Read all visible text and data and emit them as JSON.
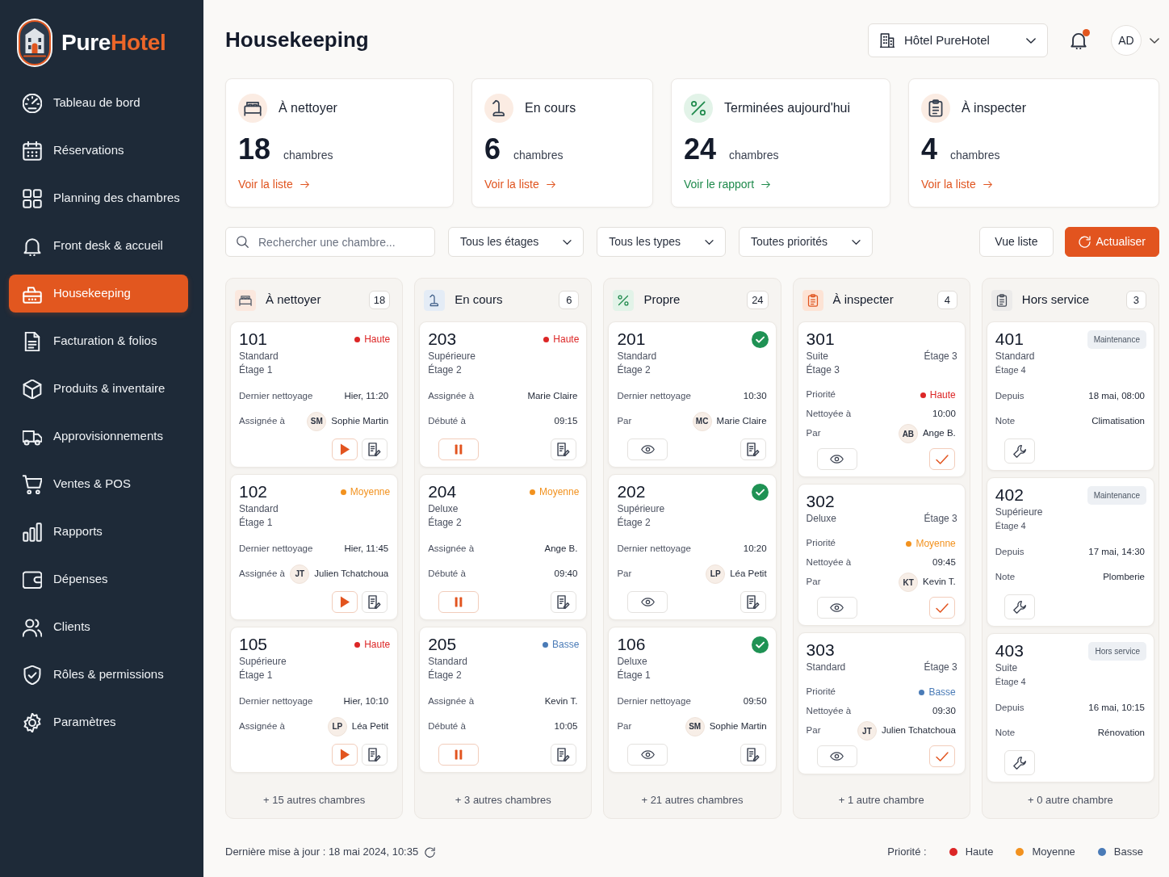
{
  "sidebar": {
    "brand": {
      "name": "Pure",
      "name_accent": "Hotel"
    },
    "items": [
      {
        "label": "Tableau de bord",
        "selected": false
      },
      {
        "label": "Réservations",
        "selected": false
      },
      {
        "label": "Planning des chambres",
        "selected": false
      },
      {
        "label": "Front desk & accueil",
        "selected": false
      },
      {
        "label": "Housekeeping",
        "selected": true
      },
      {
        "label": "Facturation & folios",
        "selected": false
      },
      {
        "label": "Produits & inventaire",
        "selected": false
      },
      {
        "label": "Approvisionnements",
        "selected": false
      },
      {
        "label": "Ventes & POS",
        "selected": false
      },
      {
        "label": "Rapports",
        "selected": false
      },
      {
        "label": "Dépenses",
        "selected": false
      },
      {
        "label": "Clients",
        "selected": false
      },
      {
        "label": "Rôles & permissions",
        "selected": false
      },
      {
        "label": "Paramètres",
        "selected": false
      }
    ]
  },
  "header": {
    "title": "Housekeeping",
    "hotel_select": {
      "value": "Hôtel PureHotel"
    },
    "notifications": {
      "unread": true
    },
    "user": {
      "initials": "AD"
    }
  },
  "stats": [
    {
      "kind": "to_clean",
      "title": "À nettoyer",
      "count": "18",
      "unit": "chambres",
      "link": "Voir la liste"
    },
    {
      "kind": "in_progress",
      "title": "En cours",
      "count": "6",
      "unit": "chambres",
      "link": "Voir la liste"
    },
    {
      "kind": "done",
      "title": "Terminées aujourd'hui",
      "count": "24",
      "unit": "chambres",
      "link": "Voir le rapport"
    },
    {
      "kind": "inspect",
      "title": "À inspecter",
      "count": "4",
      "unit": "chambres",
      "link": "Voir la liste"
    }
  ],
  "filters": {
    "search": {
      "placeholder": "Rechercher une chambre..."
    },
    "selects": [
      {
        "value": "Tous les étages"
      },
      {
        "value": "Tous les types"
      },
      {
        "value": "Toutes priorités"
      }
    ],
    "buttons": [
      {
        "kind": "view_mode",
        "label": "Vue liste"
      },
      {
        "kind": "refresh",
        "label": "Actualiser"
      }
    ]
  },
  "board": {
    "columns": [
      {
        "kind": "to_clean",
        "title": "À nettoyer",
        "count": "18",
        "cards": [
          {
            "number": "101",
            "priority": {
              "label": "Haute",
              "color": "#dc2626"
            },
            "room_type": "Standard",
            "floor": "Étage 1",
            "rows": [
              {
                "kind": "text",
                "label": "Dernier nettoyage",
                "value": "Hier, 11:20"
              },
              {
                "kind": "person",
                "label": "Assignée à",
                "initials": "SM",
                "value": "Sophie Martin"
              }
            ],
            "actions": [
              {
                "kind": "start"
              },
              {
                "kind": "notes"
              }
            ]
          },
          {
            "number": "102",
            "priority": {
              "label": "Moyenne",
              "color": "#f2921f"
            },
            "room_type": "Standard",
            "floor": "Étage 1",
            "rows": [
              {
                "kind": "text",
                "label": "Dernier nettoyage",
                "value": "Hier, 11:45"
              },
              {
                "kind": "person",
                "label": "Assignée à",
                "initials": "JT",
                "value": "Julien Tchatchoua"
              }
            ],
            "actions": [
              {
                "kind": "start"
              },
              {
                "kind": "notes"
              }
            ]
          },
          {
            "number": "105",
            "priority": {
              "label": "Haute",
              "color": "#dc2626"
            },
            "room_type": "Supérieure",
            "floor": "Étage 1",
            "rows": [
              {
                "kind": "text",
                "label": "Dernier nettoyage",
                "value": "Hier, 10:10"
              },
              {
                "kind": "person",
                "label": "Assignée à",
                "initials": "LP",
                "value": "Léa Petit"
              }
            ],
            "actions": [
              {
                "kind": "start"
              },
              {
                "kind": "notes"
              }
            ]
          }
        ],
        "more": "+ 15 autres chambres"
      },
      {
        "kind": "in_progress",
        "title": "En cours",
        "count": "6",
        "cards": [
          {
            "number": "203",
            "priority": {
              "label": "Haute",
              "color": "#dc2626"
            },
            "room_type": "Supérieure",
            "floor": "Étage 2",
            "rows": [
              {
                "kind": "text",
                "label": "Assignée à",
                "value": "Marie Claire"
              },
              {
                "kind": "text",
                "label": "Débuté à",
                "value": "09:15"
              }
            ],
            "actions": [
              {
                "kind": "pause"
              },
              {
                "kind": "notes"
              }
            ]
          },
          {
            "number": "204",
            "priority": {
              "label": "Moyenne",
              "color": "#f2921f"
            },
            "room_type": "Deluxe",
            "floor": "Étage 2",
            "rows": [
              {
                "kind": "text",
                "label": "Assignée à",
                "value": "Ange B."
              },
              {
                "kind": "text",
                "label": "Débuté à",
                "value": "09:40"
              }
            ],
            "actions": [
              {
                "kind": "pause"
              },
              {
                "kind": "notes"
              }
            ]
          },
          {
            "number": "205",
            "priority": {
              "label": "Basse",
              "color": "#4a7bb7"
            },
            "room_type": "Standard",
            "floor": "Étage 2",
            "rows": [
              {
                "kind": "text",
                "label": "Assignée à",
                "value": "Kevin T."
              },
              {
                "kind": "text",
                "label": "Débuté à",
                "value": "10:05"
              }
            ],
            "actions": [
              {
                "kind": "pause"
              },
              {
                "kind": "notes"
              }
            ]
          }
        ],
        "more": "+ 3 autres chambres"
      },
      {
        "kind": "done",
        "title": "Propre",
        "count": "24",
        "cards": [
          {
            "number": "201",
            "done": true,
            "room_type": "Standard",
            "floor": "Étage 2",
            "rows": [
              {
                "kind": "text",
                "label": "Dernier nettoyage",
                "value": "10:30"
              },
              {
                "kind": "person",
                "label": "Par",
                "initials": "MC",
                "value": "Marie Claire"
              }
            ],
            "actions": [
              {
                "kind": "view"
              },
              {
                "kind": "notes"
              }
            ]
          },
          {
            "number": "202",
            "done": true,
            "room_type": "Supérieure",
            "floor": "Étage 2",
            "rows": [
              {
                "kind": "text",
                "label": "Dernier nettoyage",
                "value": "10:20"
              },
              {
                "kind": "person",
                "label": "Par",
                "initials": "LP",
                "value": "Léa Petit"
              }
            ],
            "actions": [
              {
                "kind": "view"
              },
              {
                "kind": "notes"
              }
            ]
          },
          {
            "number": "106",
            "done": true,
            "room_type": "Deluxe",
            "floor": "Étage 1",
            "rows": [
              {
                "kind": "text",
                "label": "Dernier nettoyage",
                "value": "09:50"
              },
              {
                "kind": "person",
                "label": "Par",
                "initials": "SM",
                "value": "Sophie Martin"
              }
            ],
            "actions": [
              {
                "kind": "view"
              },
              {
                "kind": "notes"
              }
            ]
          }
        ],
        "more": "+ 21 autres chambres"
      },
      {
        "kind": "inspect",
        "title": "À inspecter",
        "count": "4",
        "cards": [
          {
            "number": "301",
            "room_type": "Suite",
            "floor_tag": "Étage 3",
            "floor": "Étage 3",
            "rows": [
              {
                "kind": "priority",
                "label": "Priorité",
                "priority": {
                  "label": "Haute",
                  "color": "#dc2626"
                }
              },
              {
                "kind": "text",
                "label": "Nettoyée à",
                "value": "10:00"
              },
              {
                "kind": "person",
                "label": "Par",
                "initials": "AB",
                "value": "Ange B."
              }
            ],
            "actions": [
              {
                "kind": "view"
              },
              {
                "kind": "approve"
              }
            ]
          },
          {
            "number": "302",
            "room_type": "Deluxe",
            "floor_tag": "Étage 3",
            "rows": [
              {
                "kind": "priority",
                "label": "Priorité",
                "priority": {
                  "label": "Moyenne",
                  "color": "#f2921f"
                }
              },
              {
                "kind": "text",
                "label": "Nettoyée à",
                "value": "09:45"
              },
              {
                "kind": "person",
                "label": "Par",
                "initials": "KT",
                "value": "Kevin T."
              }
            ],
            "actions": [
              {
                "kind": "view"
              },
              {
                "kind": "approve"
              }
            ]
          },
          {
            "number": "303",
            "room_type": "Standard",
            "floor_tag": "Étage 3",
            "rows": [
              {
                "kind": "priority",
                "label": "Priorité",
                "priority": {
                  "label": "Basse",
                  "color": "#4a7bb7"
                }
              },
              {
                "kind": "text",
                "label": "Nettoyée à",
                "value": "09:30"
              },
              {
                "kind": "person",
                "label": "Par",
                "initials": "JT",
                "value": "Julien Tchatchoua"
              }
            ],
            "actions": [
              {
                "kind": "view"
              },
              {
                "kind": "approve"
              }
            ]
          }
        ],
        "more": "+ 1 autre chambre"
      },
      {
        "kind": "out_of_service",
        "title": "Hors service",
        "count": "3",
        "cards": [
          {
            "number": "401",
            "badge": "Maintenance",
            "room_type": "Standard",
            "floor": "Étage 4",
            "rows": [
              {
                "kind": "text",
                "label": "Depuis",
                "value": "18 mai, 08:00"
              },
              {
                "kind": "text",
                "label": "Note",
                "value": "Climatisation"
              }
            ],
            "actions": [
              {
                "kind": "repair"
              }
            ]
          },
          {
            "number": "402",
            "badge": "Maintenance",
            "room_type": "Supérieure",
            "floor": "Étage 4",
            "rows": [
              {
                "kind": "text",
                "label": "Depuis",
                "value": "17 mai, 14:30"
              },
              {
                "kind": "text",
                "label": "Note",
                "value": "Plomberie"
              }
            ],
            "actions": [
              {
                "kind": "repair"
              }
            ]
          },
          {
            "number": "403",
            "badge": "Hors service",
            "room_type": "Suite",
            "floor": "Étage 4",
            "rows": [
              {
                "kind": "text",
                "label": "Depuis",
                "value": "16 mai, 10:15"
              },
              {
                "kind": "text",
                "label": "Note",
                "value": "Rénovation"
              }
            ],
            "actions": [
              {
                "kind": "repair"
              }
            ]
          }
        ],
        "more": "+ 0 autre chambre"
      }
    ]
  },
  "footer": {
    "last_update": "Dernière mise à jour : 18 mai 2024, 10:35",
    "legend": {
      "title": "Priorité :",
      "items": [
        {
          "label": "Haute",
          "color": "#dc2626"
        },
        {
          "label": "Moyenne",
          "color": "#f2921f"
        },
        {
          "label": "Basse",
          "color": "#4a7bb7"
        }
      ]
    }
  }
}
